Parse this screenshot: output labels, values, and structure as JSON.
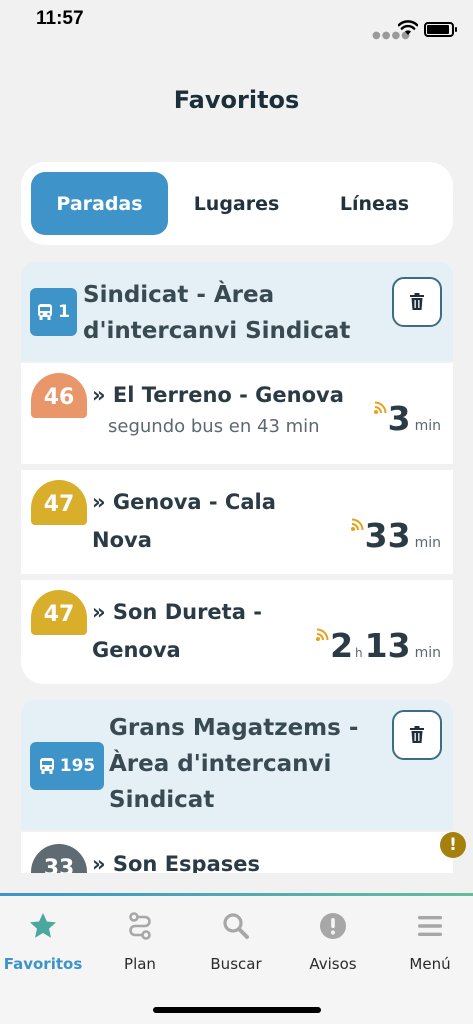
{
  "status_bar": {
    "time": "11:57"
  },
  "page": {
    "title": "Favoritos"
  },
  "tabs": [
    {
      "label": "Paradas",
      "active": true
    },
    {
      "label": "Lugares",
      "active": false
    },
    {
      "label": "Líneas",
      "active": false
    }
  ],
  "stops": [
    {
      "stop_number": "1",
      "name_line1": "Sindicat - Àrea",
      "name_line2": "d'intercanvi Sindicat",
      "arrivals": [
        {
          "line": "46",
          "color": "#e9976a",
          "dest_line1": "» El Terreno - Genova",
          "dest_line2": "",
          "second_bus": "segundo bus en 43 min",
          "eta_hours": "",
          "hour_unit": "",
          "eta_minutes": "3",
          "unit": "min"
        },
        {
          "line": "47",
          "color": "#d9ae2a",
          "dest_line1": "» Genova - Cala",
          "dest_line2": "Nova",
          "second_bus": "",
          "eta_hours": "",
          "hour_unit": "",
          "eta_minutes": "33",
          "unit": "min"
        },
        {
          "line": "47",
          "color": "#d9ae2a",
          "dest_line1": "» Son Dureta -",
          "dest_line2": "Genova",
          "second_bus": "",
          "eta_hours": "2",
          "hour_unit": "h",
          "eta_minutes": "13",
          "unit": "min"
        }
      ]
    },
    {
      "stop_number": "195",
      "name_line1": "Grans Magatzems -",
      "name_line2": "Àrea d'intercanvi",
      "name_line3": "Sindicat",
      "arrivals": [
        {
          "line": "33",
          "color": "#5f6b72",
          "dest_line1": "» Son Espases"
        }
      ]
    }
  ],
  "warning": {
    "symbol": "!"
  },
  "nav": [
    {
      "label": "Favoritos",
      "icon": "star-icon",
      "active": true
    },
    {
      "label": "Plan",
      "icon": "route-icon",
      "active": false
    },
    {
      "label": "Buscar",
      "icon": "search-icon",
      "active": false
    },
    {
      "label": "Avisos",
      "icon": "alert-icon",
      "active": false
    },
    {
      "label": "Menú",
      "icon": "menu-icon",
      "active": false
    }
  ],
  "colors": {
    "accent": "#3e94c8",
    "realtime": "#e8a21a",
    "header_bg": "#e4eff6"
  }
}
